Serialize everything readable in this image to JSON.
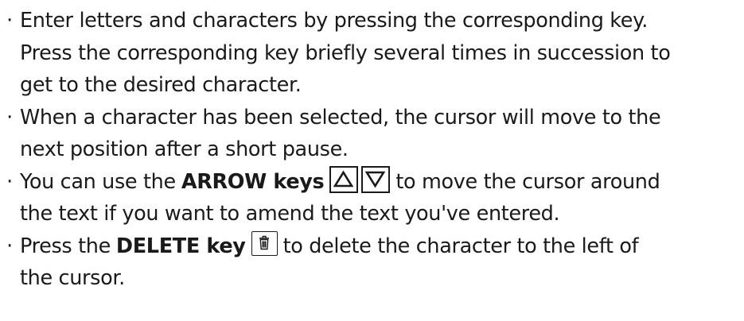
{
  "instructions": {
    "bullet_symbol": "·",
    "items": [
      {
        "lines": [
          "Enter letters and characters by pressing the corresponding key.",
          "Press the corresponding key briefly several times in succession to",
          "get to the desired character."
        ]
      },
      {
        "lines": [
          "When a character has been selected, the cursor will move to the",
          "next position after a short pause."
        ]
      },
      {
        "before": "You can use the",
        "bold": "ARROW keys",
        "keys": [
          "arrow-up-icon",
          "arrow-down-icon"
        ],
        "after": "to move the cursor around",
        "continuation": "the text if you want to amend the text you've entered."
      },
      {
        "before": "Press the",
        "bold": "DELETE key",
        "keys": [
          "trash-can-icon"
        ],
        "after": "to delete the character to the left of",
        "continuation": "the cursor."
      }
    ]
  }
}
